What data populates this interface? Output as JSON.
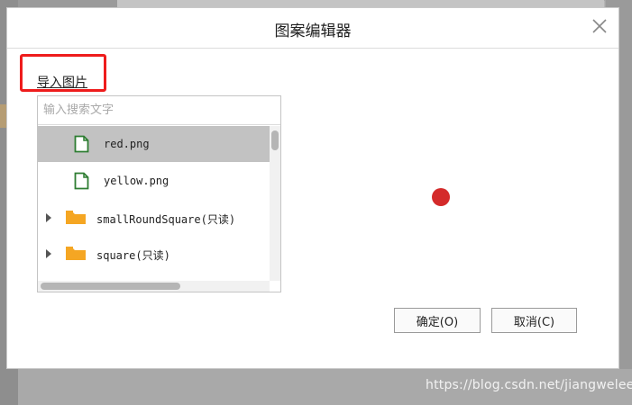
{
  "dialog": {
    "title": "图案编辑器",
    "import_label": "导入图片",
    "search_placeholder": "输入搜索文字",
    "items": [
      {
        "type": "file",
        "label": "red.png",
        "selected": true
      },
      {
        "type": "file",
        "label": "yellow.png",
        "selected": false
      },
      {
        "type": "folder",
        "label": "smallRoundSquare(只读)",
        "selected": false
      },
      {
        "type": "folder",
        "label": "square(只读)",
        "selected": false
      }
    ],
    "preview_color": "#d42a2a",
    "ok_label": "确定(O)",
    "cancel_label": "取消(C)"
  },
  "watermark": "https://blog.csdn.net/jiangwelee",
  "colors": {
    "highlight": "#ee1c1c",
    "file_icon": "#2e7d32",
    "folder_icon": "#f5a623",
    "selected_row": "#c2c2c2"
  }
}
